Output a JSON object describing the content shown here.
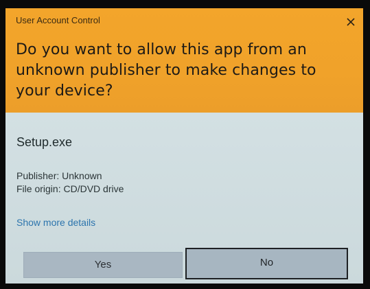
{
  "dialog": {
    "window_title": "User Account Control",
    "question": "Do you want to allow this app from an unknown publisher to make changes to your device?",
    "app_name": "Setup.exe",
    "publisher": "Publisher: Unknown",
    "file_origin": "File origin: CD/DVD drive",
    "details_link": "Show more details",
    "yes_label": "Yes",
    "no_label": "No",
    "close_icon": "close-icon"
  },
  "colors": {
    "header": "#f0a22a",
    "body": "#cfdcdf",
    "link": "#2c74ad",
    "button": "#a9b7c2"
  }
}
